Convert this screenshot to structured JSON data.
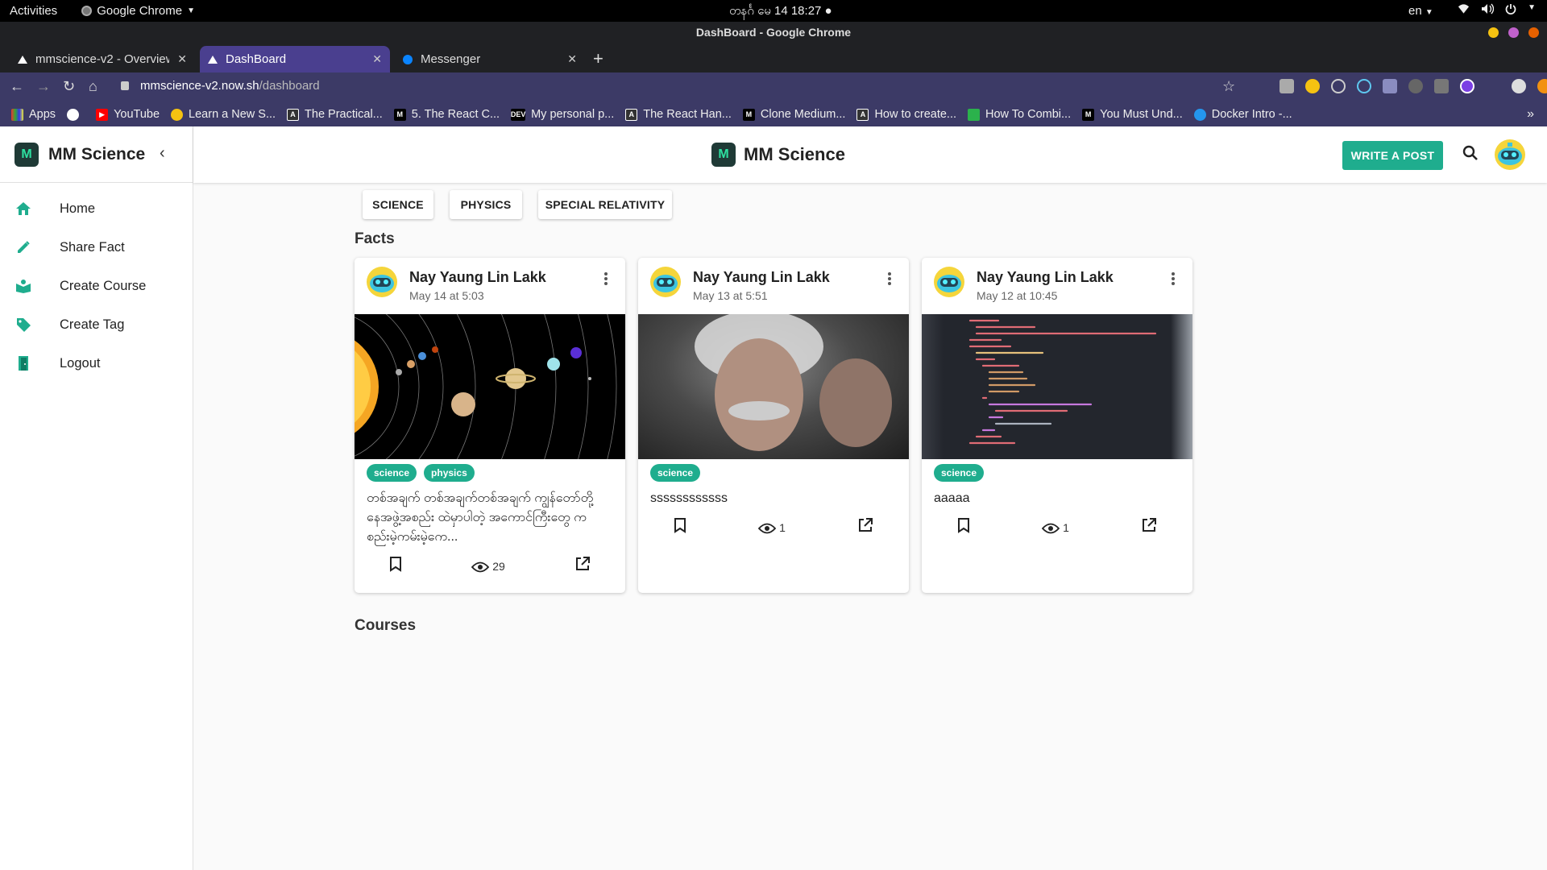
{
  "os": {
    "activities": "Activities",
    "app_name": "Google Chrome",
    "clock": "တနင်္ဂ မေ 14  18:27 ●",
    "lang": "en"
  },
  "browser": {
    "window_title": "DashBoard - Google Chrome",
    "tabs": [
      {
        "label": "mmscience-v2 - Overview"
      },
      {
        "label": "DashBoard"
      },
      {
        "label": "Messenger"
      }
    ],
    "url_host": "mmscience-v2.now.sh",
    "url_path": "/dashboard",
    "bookmarks": [
      {
        "label": "Apps"
      },
      {
        "label": ""
      },
      {
        "label": "YouTube"
      },
      {
        "label": "Learn a New S..."
      },
      {
        "label": "The Practical..."
      },
      {
        "label": "5. The React C..."
      },
      {
        "label": "My personal p..."
      },
      {
        "label": "The React Han..."
      },
      {
        "label": "Clone Medium..."
      },
      {
        "label": "How to create..."
      },
      {
        "label": "How To Combi..."
      },
      {
        "label": "You Must Und..."
      },
      {
        "label": "Docker Intro -..."
      }
    ]
  },
  "sidebar": {
    "logo_letter": "M",
    "title": "MM Science",
    "items": [
      {
        "label": "Home"
      },
      {
        "label": "Share Fact"
      },
      {
        "label": "Create Course"
      },
      {
        "label": "Create Tag"
      },
      {
        "label": "Logout"
      }
    ]
  },
  "appbar": {
    "title": "MM Science",
    "write_button": "WRITE A POST"
  },
  "tag_buttons": [
    "SCIENCE",
    "PHYSICS",
    "SPECIAL RELATIVITY"
  ],
  "sections": {
    "facts": "Facts",
    "courses": "Courses"
  },
  "cards": [
    {
      "author": "Nay Yaung Lin Lakk",
      "date": "May 14 at 5:03",
      "tags": [
        "science",
        "physics"
      ],
      "text": "တစ်အချက် တစ်အချက်တစ်အချက် ကျွန်တော်တို့ နေအဖွဲ့အစည်း ထဲမှာပါတဲ့ အကောင်ကြီးတွေ က စည်းမဲ့ကမ်းမဲ့ကေ...",
      "views": "29",
      "image": "solar-system"
    },
    {
      "author": "Nay Yaung Lin Lakk",
      "date": "May 13 at 5:51",
      "tags": [
        "science"
      ],
      "text": "ssssssssssss",
      "views": "1",
      "image": "einstein-portrait"
    },
    {
      "author": "Nay Yaung Lin Lakk",
      "date": "May 12 at 10:45",
      "tags": [
        "science"
      ],
      "text": "aaaaa",
      "views": "1",
      "image": "code-screenshot"
    }
  ],
  "colors": {
    "accent": "#1fad8e",
    "tab_active": "#4a3f8f",
    "toolbar": "#3c3a66"
  }
}
